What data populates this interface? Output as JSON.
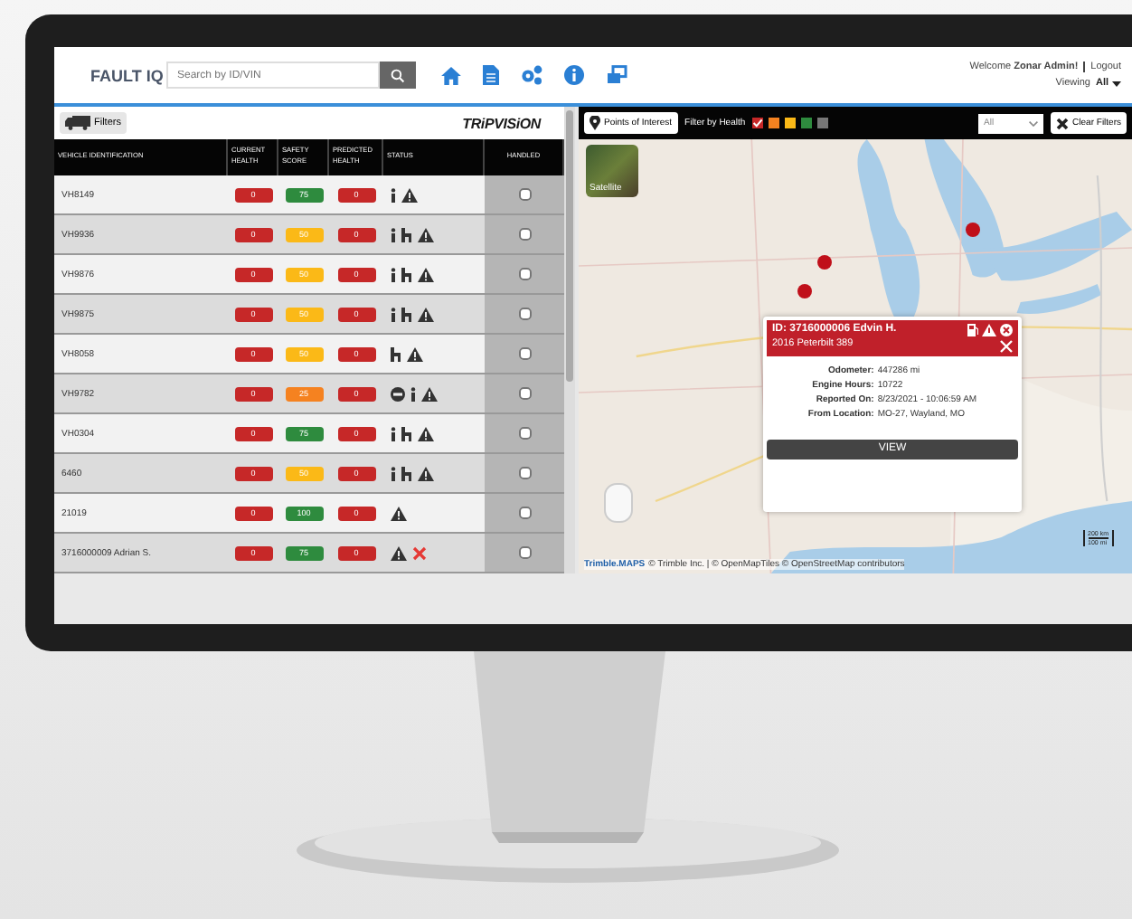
{
  "header": {
    "logo": "FAULT IQ",
    "search": {
      "placeholder": "Search by ID/VIN"
    },
    "welcome": "Welcome",
    "user_name": "Zonar Admin!",
    "logout": "Logout",
    "viewing_label": "Viewing",
    "viewing_value": "All"
  },
  "left_panel": {
    "filters_button": "Filters",
    "brand": "TRiPVISiON",
    "columns": [
      "VEHICLE IDENTIFICATION",
      "CURRENT HEALTH",
      "SAFETY SCORE",
      "PREDICTED HEALTH",
      "STATUS",
      "HANDLED"
    ],
    "rows": [
      {
        "vehicle": "VH8149",
        "current_health": "0",
        "safety_score": "75",
        "color": "#2e8b3e",
        "predicted_health": "0",
        "status": [
          {
            "kind": "info"
          },
          {
            "kind": "warning"
          }
        ],
        "handled": false
      },
      {
        "vehicle": "VH9936",
        "current_health": "0",
        "safety_score": "50",
        "color": "#fbb917",
        "predicted_health": "0",
        "status": [
          {
            "kind": "info"
          },
          {
            "kind": "hook"
          },
          {
            "kind": "warning"
          }
        ],
        "handled": false
      },
      {
        "vehicle": "VH9876",
        "current_health": "0",
        "safety_score": "50",
        "color": "#fbb917",
        "predicted_health": "0",
        "status": [
          {
            "kind": "info"
          },
          {
            "kind": "hook"
          },
          {
            "kind": "warning"
          }
        ],
        "handled": false
      },
      {
        "vehicle": "VH9875",
        "current_health": "0",
        "safety_score": "50",
        "color": "#fbb917",
        "predicted_health": "0",
        "status": [
          {
            "kind": "info"
          },
          {
            "kind": "hook"
          },
          {
            "kind": "warning"
          }
        ],
        "handled": false
      },
      {
        "vehicle": "VH8058",
        "current_health": "0",
        "safety_score": "50",
        "color": "#fbb917",
        "predicted_health": "0",
        "status": [
          {
            "kind": "hook"
          },
          {
            "kind": "warning"
          }
        ],
        "handled": false
      },
      {
        "vehicle": "VH9782",
        "current_health": "0",
        "safety_score": "25",
        "color": "#f58220",
        "predicted_health": "0",
        "status": [
          {
            "kind": "stop"
          },
          {
            "kind": "info"
          },
          {
            "kind": "warning"
          }
        ],
        "handled": false
      },
      {
        "vehicle": "VH0304",
        "current_health": "0",
        "safety_score": "75",
        "color": "#2e8b3e",
        "predicted_health": "0",
        "status": [
          {
            "kind": "info"
          },
          {
            "kind": "hook"
          },
          {
            "kind": "warning"
          }
        ],
        "handled": false
      },
      {
        "vehicle": "6460",
        "current_health": "0",
        "safety_score": "50",
        "color": "#fbb917",
        "predicted_health": "0",
        "status": [
          {
            "kind": "info"
          },
          {
            "kind": "hook"
          },
          {
            "kind": "warning"
          }
        ],
        "handled": false
      },
      {
        "vehicle": "21019",
        "current_health": "0",
        "safety_score": "100",
        "color": "#2e8b3e",
        "predicted_health": "0",
        "status": [
          {
            "kind": "warning"
          }
        ],
        "handled": false
      },
      {
        "vehicle": "3716000009 Adrian S.",
        "current_health": "0",
        "safety_score": "75",
        "color": "#2e8b3e",
        "predicted_health": "0",
        "status": [
          {
            "kind": "warning"
          },
          {
            "kind": "tools"
          }
        ],
        "handled": false
      }
    ]
  },
  "map_toolbar": {
    "poi_button": "Points of Interest",
    "filter_label": "Filter by Health",
    "health_filters": [
      {
        "color": "#c62828",
        "checked": true
      },
      {
        "color": "#f58220",
        "checked": false
      },
      {
        "color": "#fbb917",
        "checked": false
      },
      {
        "color": "#2e8b3e",
        "checked": false
      },
      {
        "color": "#777777",
        "checked": false
      }
    ],
    "select": "All",
    "clear_button": "Clear Filters"
  },
  "map": {
    "satellite": "Satellite",
    "popup": {
      "title": "ID: 3716000006 Edvin H.",
      "subtitle": "2016 Peterbilt 389",
      "fields": [
        {
          "label": "Odometer:",
          "value": "447286 mi"
        },
        {
          "label": "Engine Hours:",
          "value": "10722"
        },
        {
          "label": "Reported On:",
          "value": "8/23/2021 - 10:06:59 AM"
        },
        {
          "label": "From Location:",
          "value": "MO-27, Wayland, MO"
        }
      ],
      "button": "VIEW"
    },
    "scale": [
      "200 km",
      "100 mi"
    ],
    "attribution_logo": "Trimble.MAPS",
    "attribution": "© Trimble Inc. | © OpenMapTiles © OpenStreetMap contributors"
  }
}
